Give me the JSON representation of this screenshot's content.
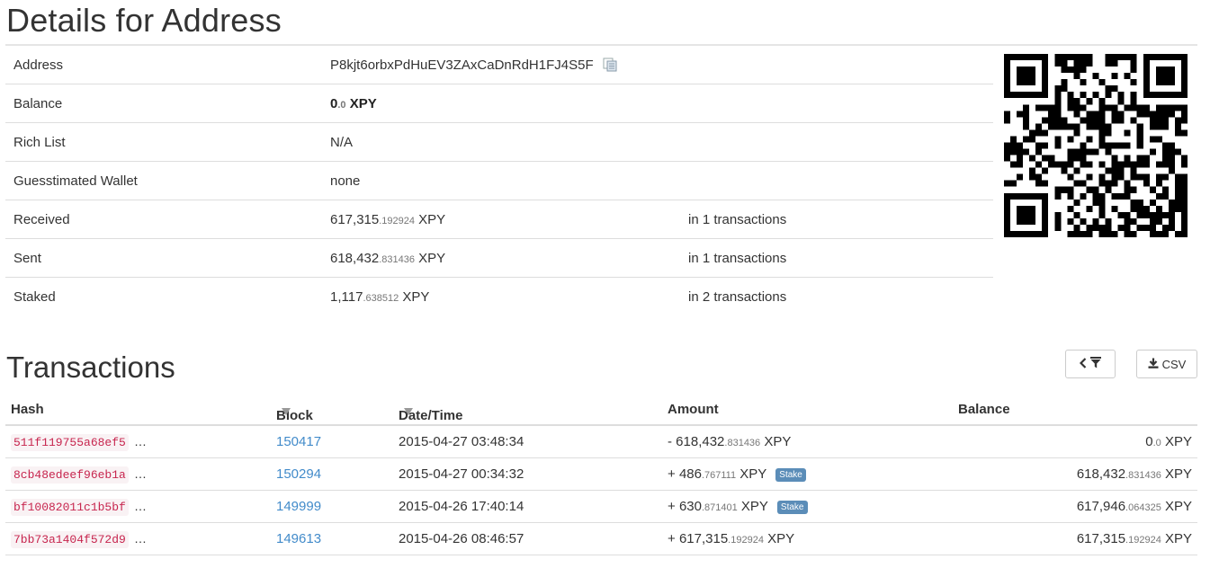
{
  "page": {
    "title": "Details for Address"
  },
  "details": {
    "rows": [
      {
        "key": "Address",
        "value": "P8kjt6orbxPdHuEV3ZAxCaDnRdH1FJ4S5F",
        "extra": ""
      },
      {
        "key": "Balance",
        "value_main": "0",
        "value_frac": ".0",
        "value_unit": "XPY"
      },
      {
        "key": "Rich List",
        "value": "N/A"
      },
      {
        "key": "Guesstimated Wallet",
        "value": "none"
      },
      {
        "key": "Received",
        "value_main": "617,315",
        "value_frac": ".192924",
        "value_unit": "XPY",
        "extra": "in 1 transactions"
      },
      {
        "key": "Sent",
        "value_main": "618,432",
        "value_frac": ".831436",
        "value_unit": "XPY",
        "extra": "in 1 transactions"
      },
      {
        "key": "Staked",
        "value_main": "1,117",
        "value_frac": ".638512",
        "value_unit": "XPY",
        "extra": "in 2 transactions"
      }
    ]
  },
  "transactions": {
    "title": "Transactions",
    "filter_icon": "chevron-left-filter-icon",
    "csv_label": "CSV",
    "headers": {
      "hash": "Hash",
      "block": "Block",
      "datetime": "Date/Time",
      "amount": "Amount",
      "balance": "Balance"
    },
    "rows": [
      {
        "hash": "511f119755a68ef5",
        "dots": "…",
        "block": "150417",
        "datetime": "2015-04-27 03:48:34",
        "amount_sign": "- ",
        "amount_main": "618,432",
        "amount_frac": ".831436",
        "amount_unit": "XPY",
        "badge": "",
        "bal_main": "0",
        "bal_frac": ".0",
        "bal_unit": "XPY"
      },
      {
        "hash": "8cb48edeef96eb1a",
        "dots": "…",
        "block": "150294",
        "datetime": "2015-04-27 00:34:32",
        "amount_sign": "+ ",
        "amount_main": "486",
        "amount_frac": ".767111",
        "amount_unit": "XPY",
        "badge": "Stake",
        "bal_main": "618,432",
        "bal_frac": ".831436",
        "bal_unit": "XPY"
      },
      {
        "hash": "bf10082011c1b5bf",
        "dots": "…",
        "block": "149999",
        "datetime": "2015-04-26 17:40:14",
        "amount_sign": "+ ",
        "amount_main": "630",
        "amount_frac": ".871401",
        "amount_unit": "XPY",
        "badge": "Stake",
        "bal_main": "617,946",
        "bal_frac": ".064325",
        "bal_unit": "XPY"
      },
      {
        "hash": "7bb73a1404f572d9",
        "dots": "…",
        "block": "149613",
        "datetime": "2015-04-26 08:46:57",
        "amount_sign": "+ ",
        "amount_main": "617,315",
        "amount_frac": ".192924",
        "amount_unit": "XPY",
        "badge": "",
        "bal_main": "617,315",
        "bal_frac": ".192924",
        "bal_unit": "XPY"
      }
    ]
  },
  "colors": {
    "link": "#428bca",
    "hash_text": "#c7254e",
    "hash_bg": "#f9f2f4",
    "badge": "#5b8db8"
  }
}
